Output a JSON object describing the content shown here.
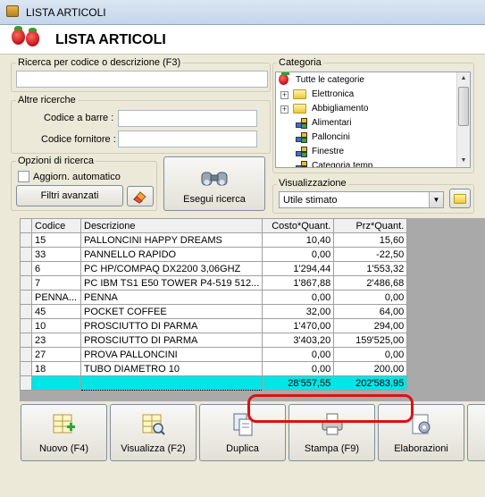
{
  "window": {
    "title": "LISTA ARTICOLI"
  },
  "header": {
    "title": "LISTA ARTICOLI"
  },
  "search": {
    "group_label": "Ricerca per codice o descrizione (F3)",
    "value": ""
  },
  "other_search": {
    "group_label": "Altre ricerche",
    "barcode_label": "Codice a barre :",
    "barcode_value": "",
    "supplier_label": "Codice fornitore :",
    "supplier_value": ""
  },
  "options": {
    "group_label": "Opzioni di ricerca",
    "auto_update_label": "Aggiorn. automatico",
    "auto_update_checked": false,
    "advanced_filters_label": "Filtri avanzati"
  },
  "search_button": {
    "label": "Esegui ricerca"
  },
  "category": {
    "group_label": "Categoria",
    "items": [
      {
        "label": "Tutte le categorie",
        "icon": "strawberry-icon"
      },
      {
        "label": "Elettronica",
        "icon": "folder-icon"
      },
      {
        "label": "Abbigliamento",
        "icon": "folder-icon"
      },
      {
        "label": "Alimentari",
        "icon": "cubes-icon"
      },
      {
        "label": "Palloncini",
        "icon": "cubes-icon"
      },
      {
        "label": "Finestre",
        "icon": "cubes-icon"
      },
      {
        "label": "Categoria temp",
        "icon": "cubes-icon"
      }
    ]
  },
  "view": {
    "group_label": "Visualizzazione",
    "selected": "Utile stimato"
  },
  "grid": {
    "columns": [
      "Codice",
      "Descrizione",
      "Costo*Quant.",
      "Prz*Quant."
    ],
    "rows": [
      [
        "15",
        "PALLONCINI HAPPY DREAMS",
        "10,40",
        "15,60"
      ],
      [
        "33",
        "PANNELLO RAPIDO",
        "0,00",
        "-22,50"
      ],
      [
        "6",
        "PC HP/COMPAQ DX2200 3,06GHZ",
        "1'294,44",
        "1'553,32"
      ],
      [
        "7",
        "PC IBM TS1 E50 TOWER P4-519 512...",
        "1'867,88",
        "2'486,68"
      ],
      [
        "PENNA...",
        "PENNA",
        "0,00",
        "0,00"
      ],
      [
        "45",
        "POCKET COFFEE",
        "32,00",
        "64,00"
      ],
      [
        "10",
        "PROSCIUTTO DI PARMA",
        "1'470,00",
        "294,00"
      ],
      [
        "23",
        "PROSCIUTTO DI PARMA",
        "3'403,20",
        "159'525,00"
      ],
      [
        "27",
        "PROVA PALLONCINI",
        "0,00",
        "0,00"
      ],
      [
        "18",
        "TUBO DIAMETRO 10",
        "0,00",
        "200,00"
      ]
    ],
    "totals": {
      "cost": "28'557,55",
      "price": "202'583,95"
    }
  },
  "toolbar": {
    "new_label": "Nuovo (F4)",
    "view_label": "Visualizza (F2)",
    "duplicate_label": "Duplica",
    "print_label": "Stampa (F9)",
    "process_label": "Elaborazioni"
  }
}
